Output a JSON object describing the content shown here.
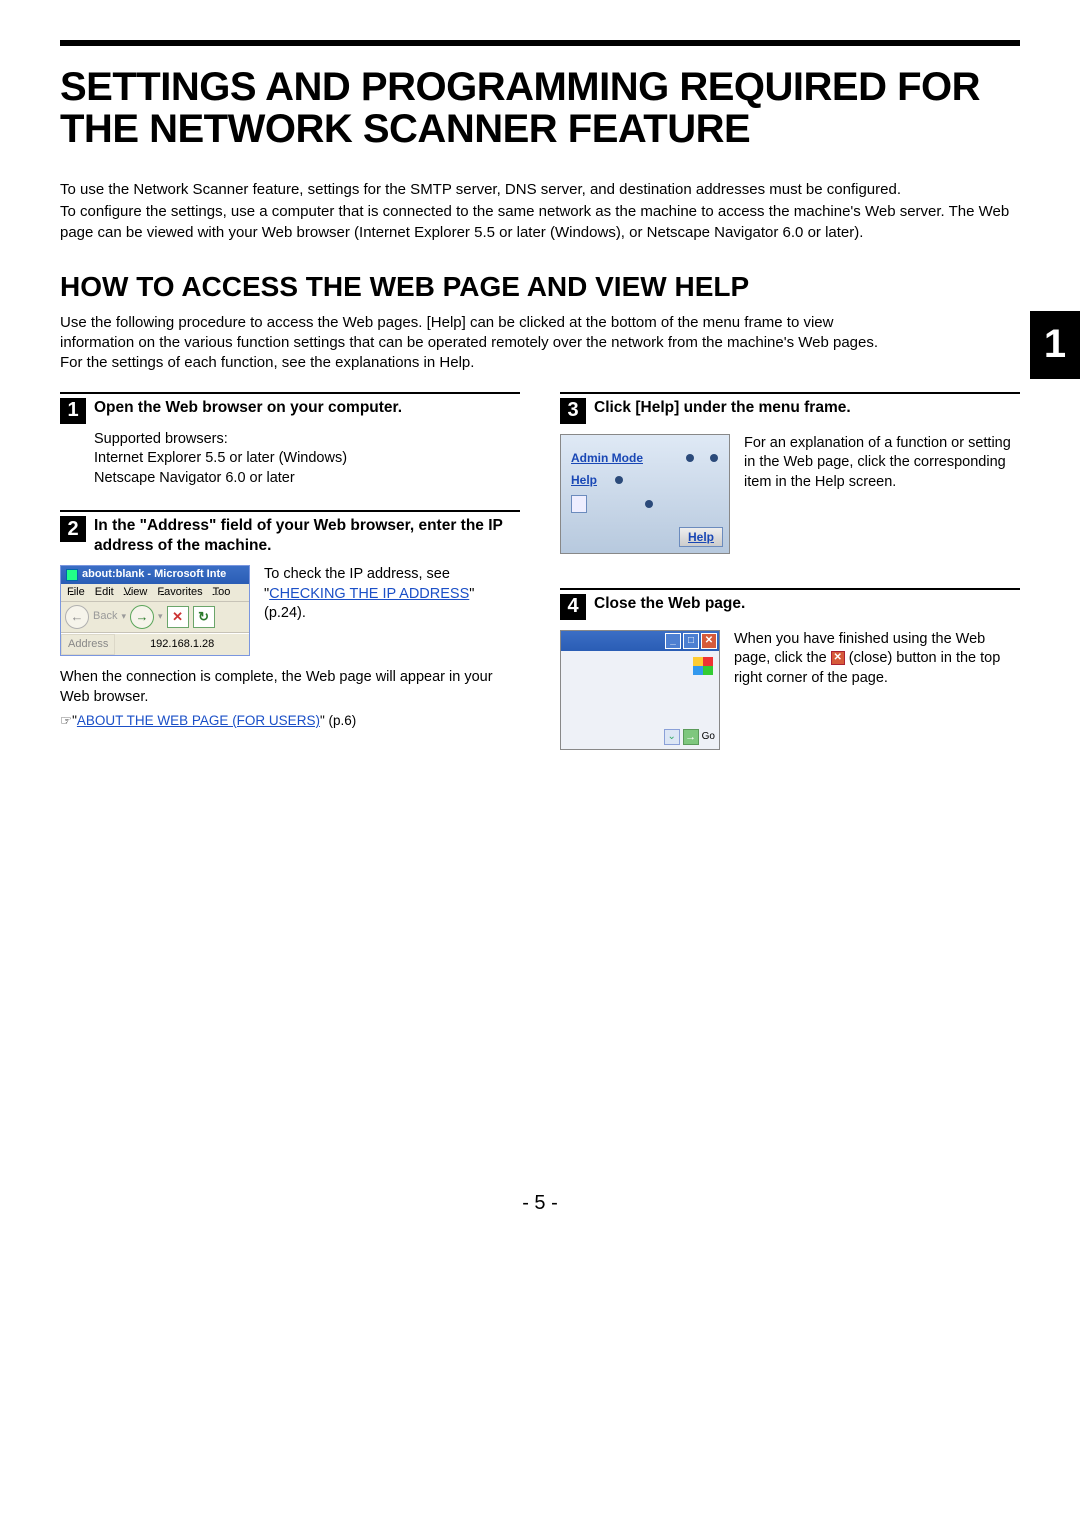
{
  "title": "SETTINGS AND PROGRAMMING REQUIRED FOR THE NETWORK SCANNER FEATURE",
  "intro": {
    "p1": "To use the Network Scanner feature, settings for the SMTP server, DNS server, and destination addresses must be configured.",
    "p2": "To configure the settings, use a computer that is connected to the same network as the machine to access the machine's Web server. The Web page can be viewed with your Web browser (Internet Explorer 5.5 or later (Windows), or Netscape Navigator 6.0 or later)."
  },
  "section_tab": "1",
  "h2": "HOW TO ACCESS THE WEB PAGE AND VIEW HELP",
  "sub_intro": "Use the following procedure to access the Web pages. [Help] can be clicked at the bottom of the menu frame to view information on the various function settings that can be operated remotely over the network from the machine's Web pages. For the settings of each function, see the explanations in Help.",
  "steps": {
    "s1": {
      "num": "1",
      "title": "Open the Web browser on your computer.",
      "body_l1": "Supported browsers:",
      "body_l2": "Internet Explorer 5.5 or later (Windows)",
      "body_l3": "Netscape Navigator 6.0 or later"
    },
    "s2": {
      "num": "2",
      "title": "In the \"Address\" field of your Web browser, enter the IP address of the machine.",
      "fig": {
        "titlebar": "about:blank - Microsoft Inte",
        "menu": {
          "file": "File",
          "edit": "Edit",
          "view": "View",
          "fav": "Favorites",
          "tools": "Too"
        },
        "back": "Back",
        "address_label": "Address",
        "address_value": "192.168.1.28"
      },
      "side_pre": "To check the IP address, see \"",
      "side_link": "CHECKING THE IP ADDRESS",
      "side_post": "\" (p.24).",
      "after": "When the connection is complete, the Web page will appear in your Web browser.",
      "ref_link": "ABOUT THE WEB PAGE (FOR USERS)",
      "ref_suffix": "\" (p.6)"
    },
    "s3": {
      "num": "3",
      "title": "Click [Help] under the menu frame.",
      "fig": {
        "admin": "Admin Mode",
        "help": "Help",
        "help_btn": "Help"
      },
      "side": "For an explanation of a function or setting in the Web page, click the corresponding item in the Help screen."
    },
    "s4": {
      "num": "4",
      "title": "Close the Web page.",
      "fig": {
        "go": "Go"
      },
      "side_pre": "When you have finished using the Web page, click the ",
      "side_mid": " (close) button in the top right corner of the page."
    }
  },
  "page_number": "- 5 -"
}
